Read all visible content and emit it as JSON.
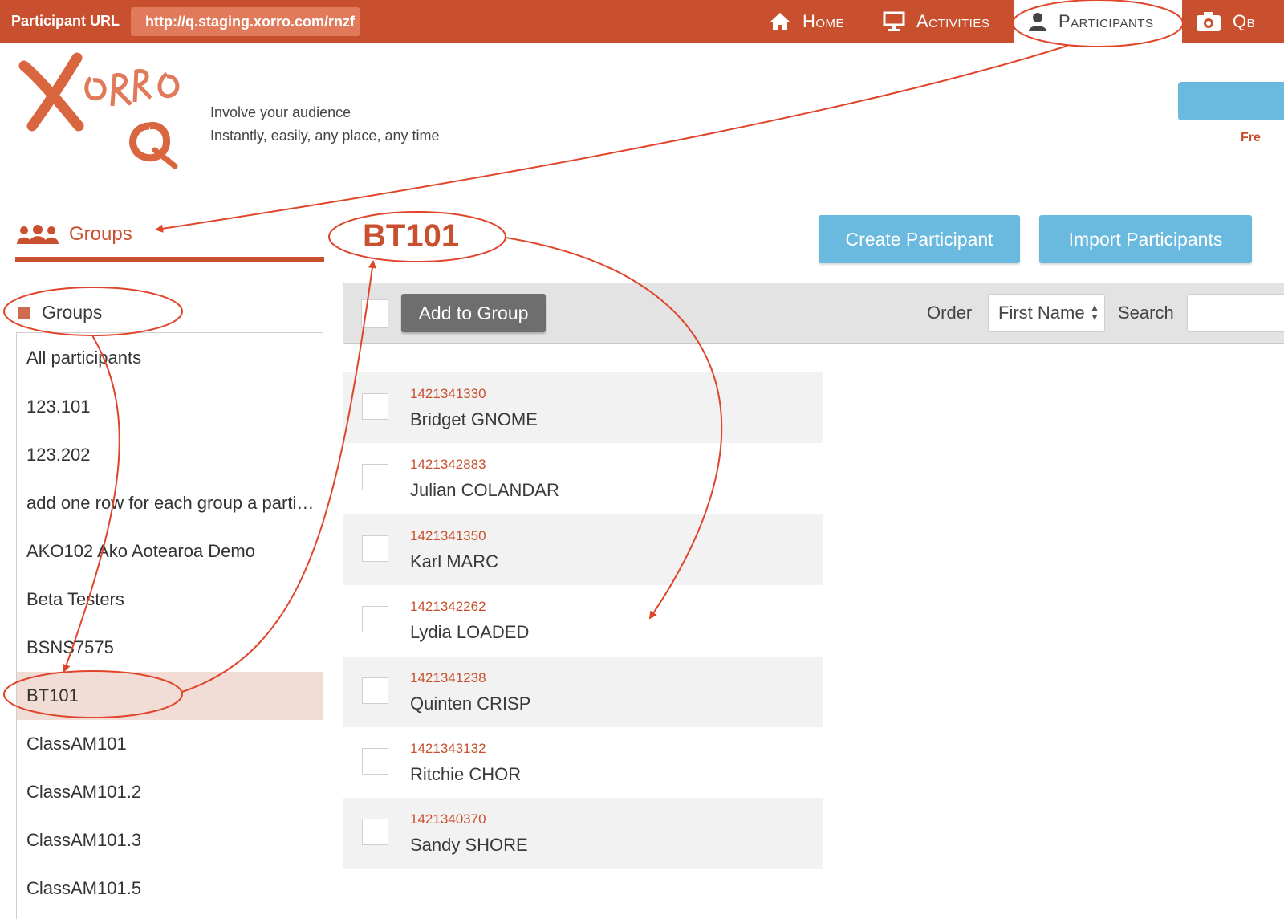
{
  "topbar": {
    "participant_url_label": "Participant URL",
    "participant_url": "http://q.staging.xorro.com/rnzf",
    "nav": {
      "home": "Home",
      "activities": "Activities",
      "participants": "Participants",
      "qbank": "Qb"
    }
  },
  "header": {
    "logo_text": "Xorro Q",
    "tagline_line1": "Involve your audience",
    "tagline_line2": "Instantly, easily, any place, any time",
    "free_text": "Fre"
  },
  "sidebar": {
    "heading": "Groups",
    "subheading": "Groups",
    "groups": [
      "All participants",
      "123.101",
      "123.202",
      "add one row for each group a participant belongs to",
      "AKO102 Ako Aotearoa Demo",
      "Beta Testers",
      "BSNS7575",
      "BT101",
      "ClassAM101",
      "ClassAM101.2",
      "ClassAM101.3",
      "ClassAM101.5"
    ],
    "selected_group": "BT101"
  },
  "main": {
    "group_title": "BT101",
    "create_label": "Create Participant",
    "import_label": "Import Participants",
    "toolbar": {
      "add_to_group_label": "Add to Group",
      "order_label": "Order",
      "order_value": "First Name",
      "search_label": "Search"
    },
    "participants": [
      {
        "id": "1421341330",
        "name": "Bridget GNOME"
      },
      {
        "id": "1421342883",
        "name": "Julian COLANDAR"
      },
      {
        "id": "1421341350",
        "name": "Karl MARC"
      },
      {
        "id": "1421342262",
        "name": "Lydia LOADED"
      },
      {
        "id": "1421341238",
        "name": "Quinten CRISP"
      },
      {
        "id": "1421343132",
        "name": "Ritchie CHOR"
      },
      {
        "id": "1421340370",
        "name": "Sandy SHORE"
      }
    ]
  },
  "colors": {
    "brand": "#c9502e",
    "button_blue": "#6ab9de",
    "button_gray": "#6e6e6e",
    "selected_row": "#f2dcd6",
    "annotation": "#e0442a"
  },
  "icons": [
    "home-icon",
    "presentation-icon",
    "person-icon",
    "camera-icon",
    "people-group-icon"
  ]
}
